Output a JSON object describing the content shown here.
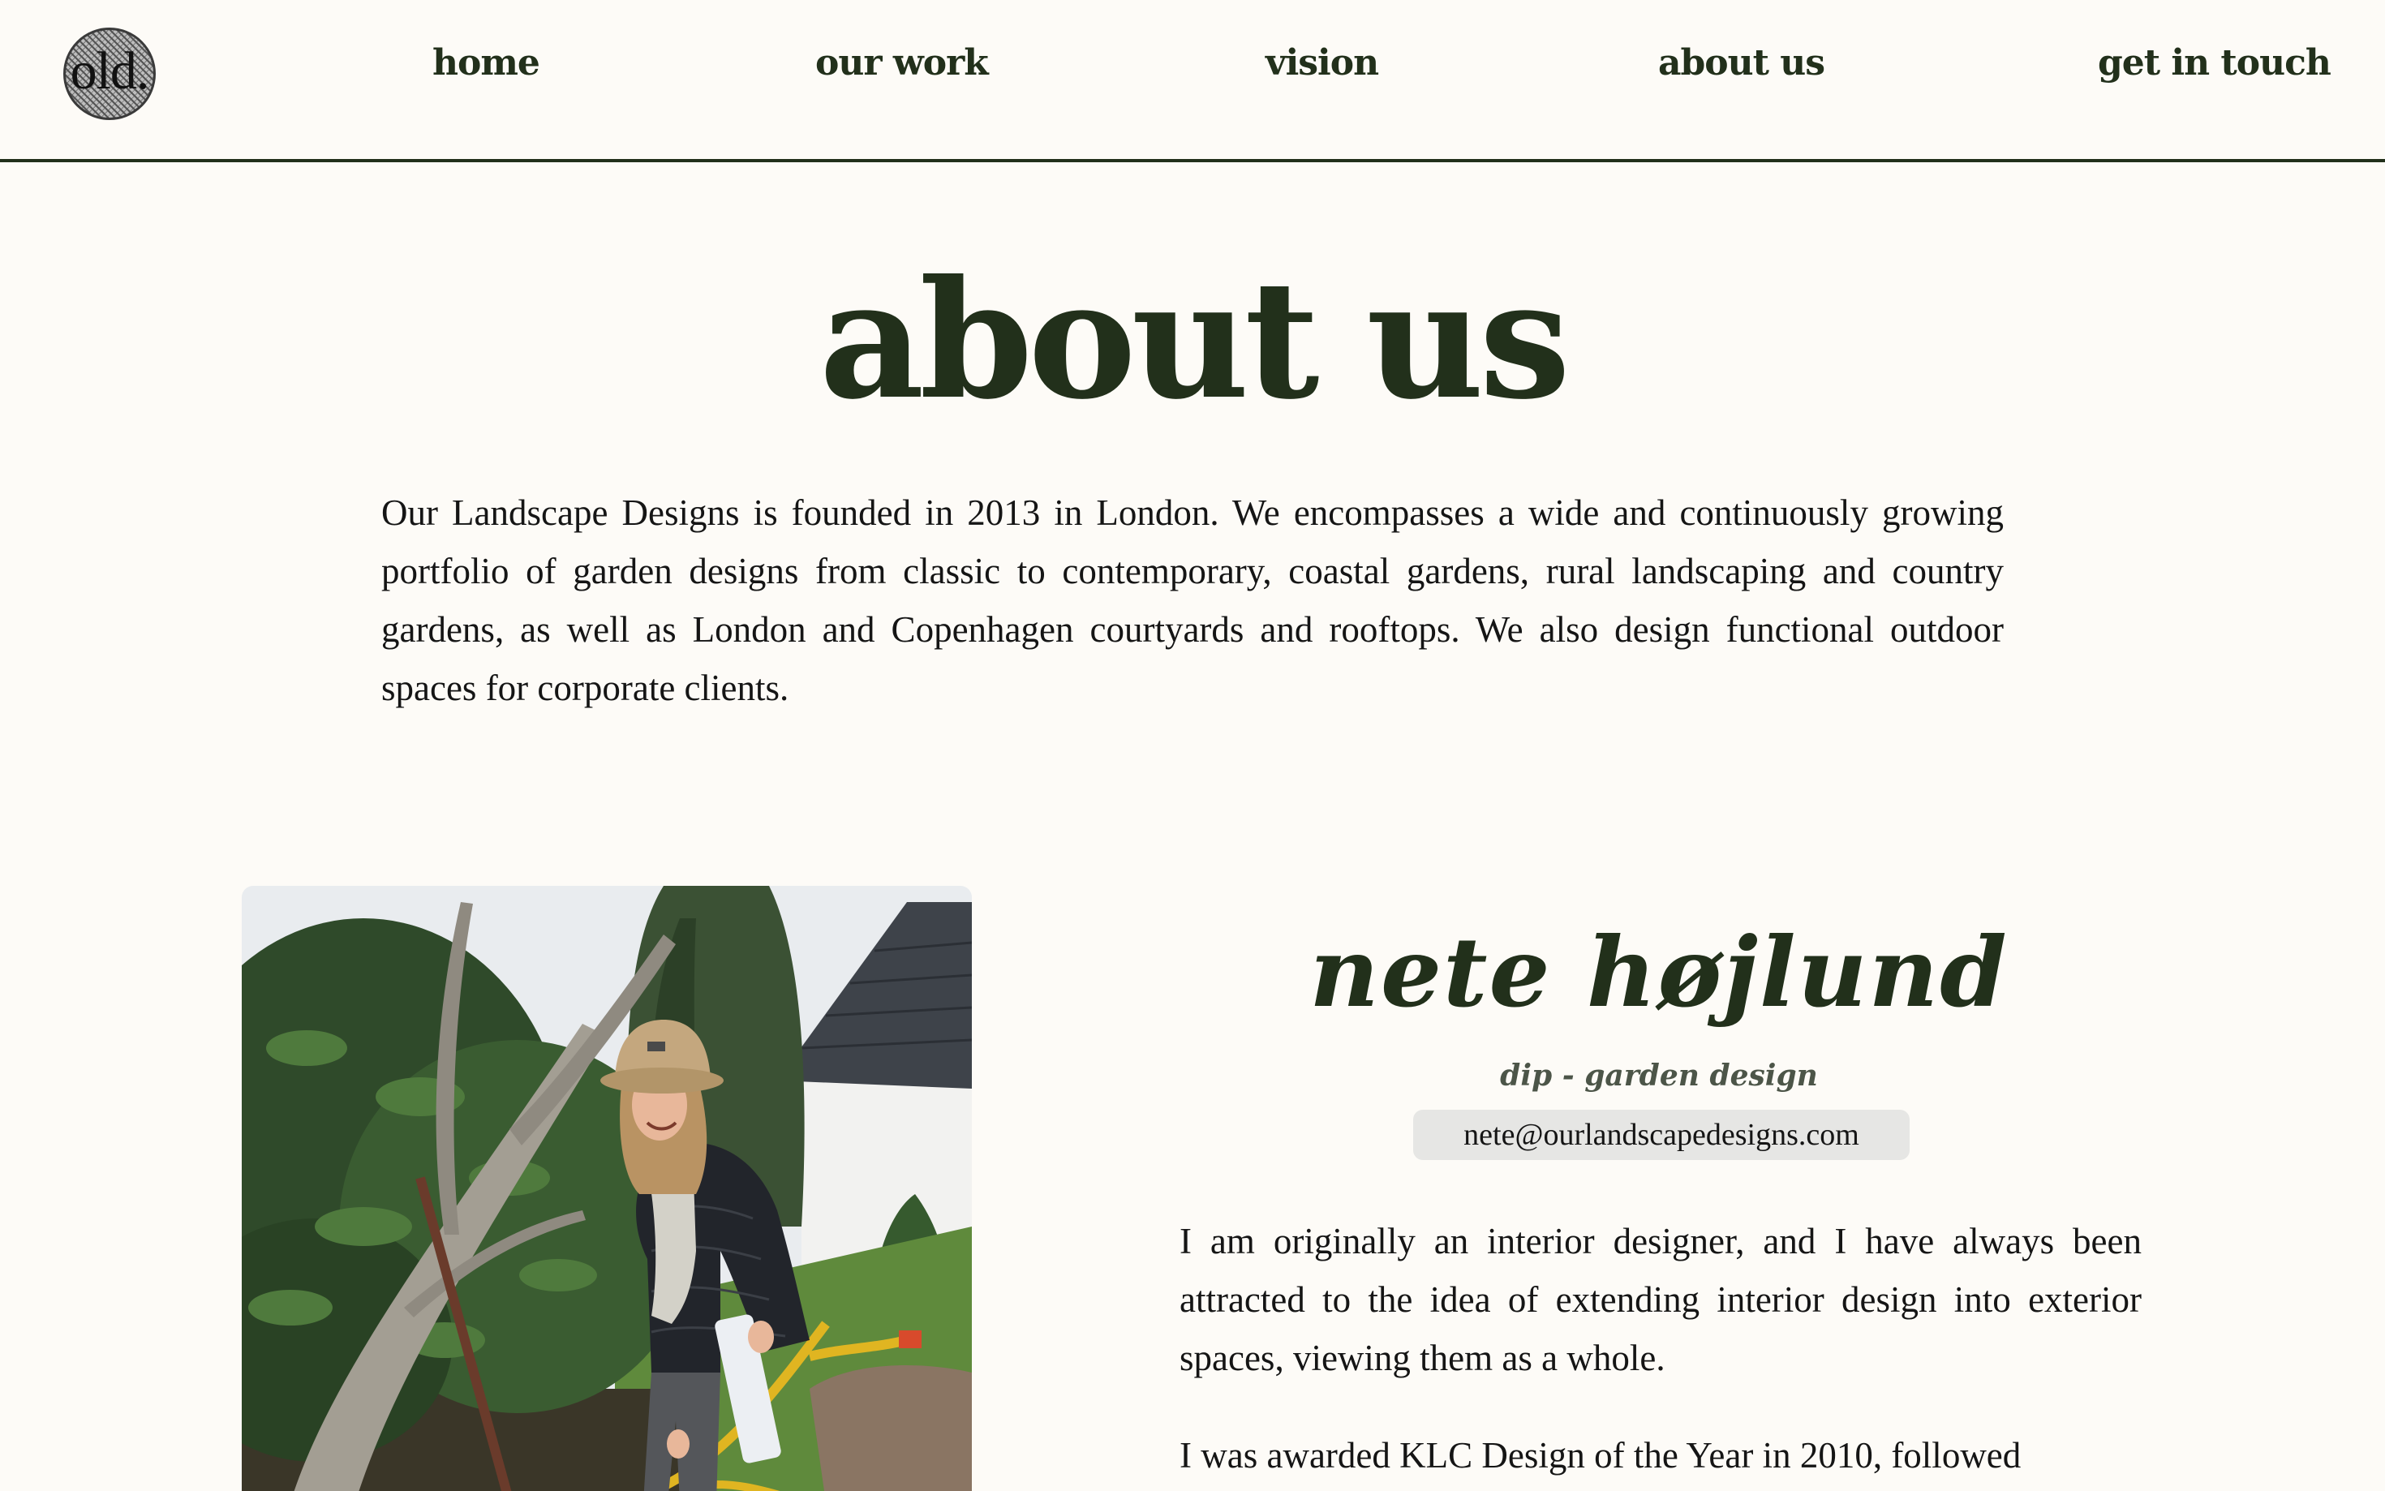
{
  "header": {
    "logo_text": "old.",
    "nav": [
      {
        "label": "home"
      },
      {
        "label": "our work"
      },
      {
        "label": "vision"
      },
      {
        "label": "about us"
      },
      {
        "label": "get in touch"
      }
    ]
  },
  "main": {
    "title": "about us",
    "intro": "Our Landscape Designs is founded in 2013 in London. We encompasses a wide and continuously growing portfolio of garden designs from classic to contemporary, coastal gardens, rural landscaping and country gardens, as well as London and Copenhagen courtyards and rooftops. We also design functional outdoor spaces for corporate clients."
  },
  "profile": {
    "name": "nete højlund",
    "credential": "dip - garden design",
    "email": "nete@ourlandscapedesigns.com",
    "bio": [
      "I am originally an interior designer, and I have always been attracted to the idea of extending interior design into exterior spaces, viewing them as a whole.",
      "I was awarded KLC Design of the Year in 2010, followed"
    ]
  },
  "colors": {
    "background": "#fdfbf7",
    "brand_dark_green": "#22301b",
    "email_badge": "#e6e6e4"
  }
}
